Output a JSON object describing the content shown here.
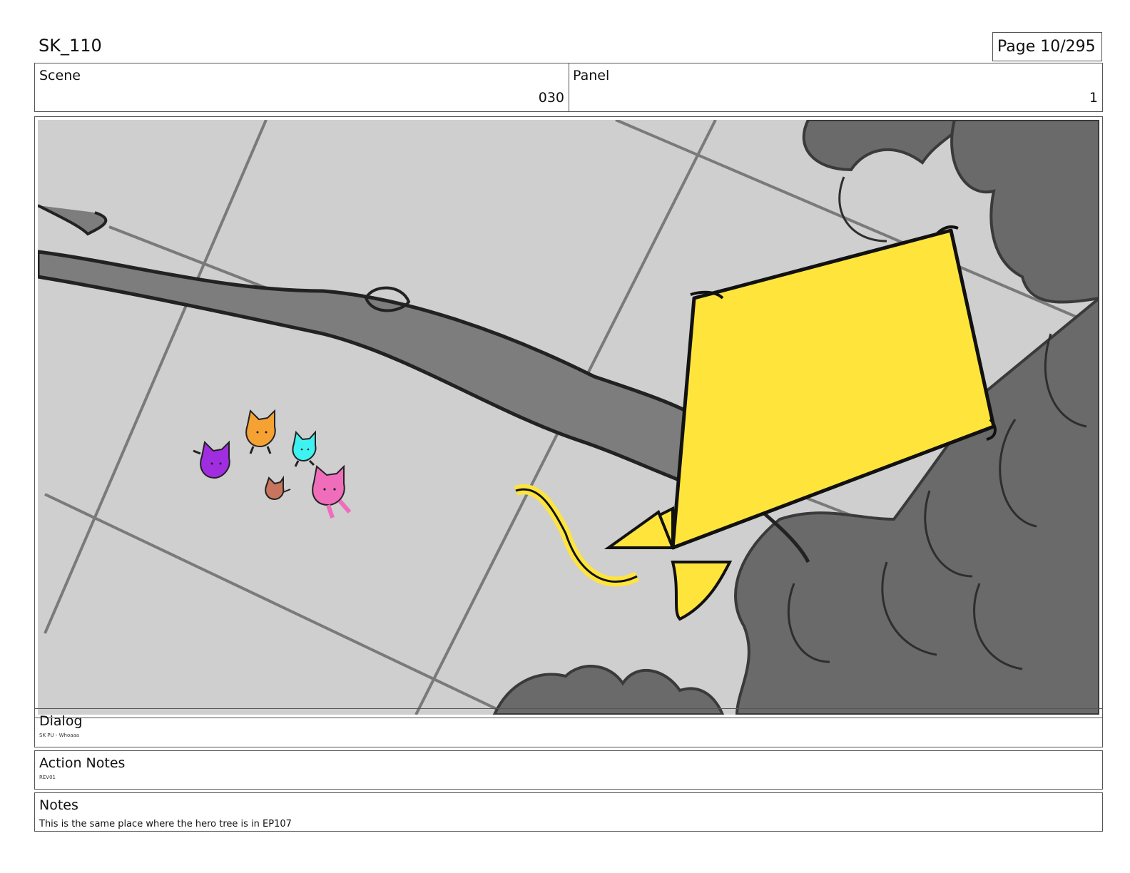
{
  "sheet": {
    "code": "SK_110",
    "page": "Page  10/295"
  },
  "header": {
    "scene_label": "Scene",
    "scene_value": "030",
    "panel_label": "Panel",
    "panel_value": "1"
  },
  "dialog": {
    "label": "Dialog",
    "text": "SK PU - Whoaaa"
  },
  "action_notes": {
    "label": "Action Notes",
    "text": "REV01"
  },
  "notes": {
    "label": "Notes",
    "text": "This is the same place where the hero tree is in EP107"
  },
  "colors": {
    "floor": "#cfcfcf",
    "tile_line": "#7a7a7a",
    "branch": "#7d7d7d",
    "kite": "#ffe53b",
    "kitten_purple": "#a02de0",
    "kitten_orange": "#f5a233",
    "kitten_cyan": "#3ff2f2",
    "kitten_pink": "#f06dbb",
    "kitten_brown": "#c9745e"
  }
}
